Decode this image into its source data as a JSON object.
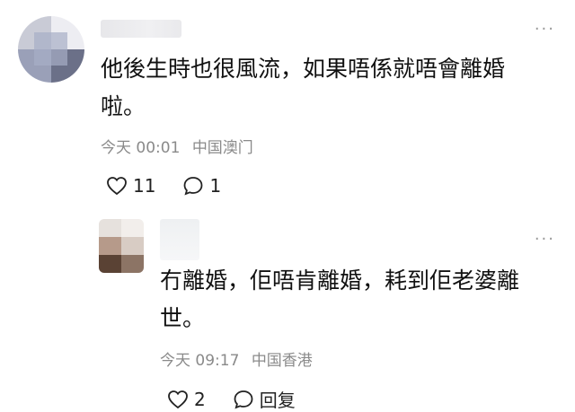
{
  "comments": [
    {
      "text_line1": "他後生時也很風流，如果唔係就唔會離婚",
      "text_line2": "啦。",
      "time": "今天 00:01",
      "location": "中国澳门",
      "like_count": "11",
      "reply_count": "1",
      "more_icon": "ellipsis-icon"
    },
    {
      "text_line1": "冇離婚，佢唔肯離婚，耗到佢老婆離",
      "text_line2": "世。",
      "time": "今天 09:17",
      "location": "中国香港",
      "like_count": "2",
      "reply_label": "回复",
      "more_icon": "ellipsis-icon"
    }
  ]
}
